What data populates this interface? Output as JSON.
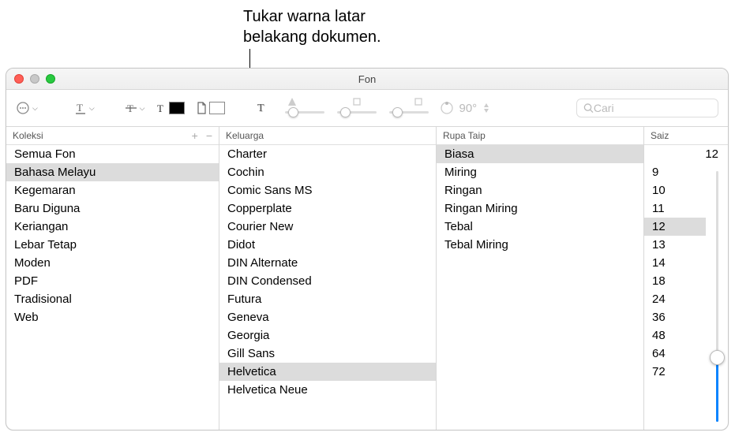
{
  "callout": "Tukar warna latar\nbelakang dokumen.",
  "window": {
    "title": "Fon",
    "search_placeholder": "Cari",
    "angle_label": "90°"
  },
  "headers": {
    "koleksi": "Koleksi",
    "keluarga": "Keluarga",
    "rupa": "Rupa Taip",
    "saiz": "Saiz",
    "plus": "+",
    "minus": "−"
  },
  "koleksi": {
    "items": [
      "Semua Fon",
      "Bahasa Melayu",
      "Kegemaran",
      "Baru Diguna",
      "Keriangan",
      "Lebar Tetap",
      "Moden",
      "PDF",
      "Tradisional",
      "Web"
    ],
    "selected": "Bahasa Melayu"
  },
  "keluarga": {
    "items": [
      "Charter",
      "Cochin",
      "Comic Sans MS",
      "Copperplate",
      "Courier New",
      "Didot",
      "DIN Alternate",
      "DIN Condensed",
      "Futura",
      "Geneva",
      "Georgia",
      "Gill Sans",
      "Helvetica",
      "Helvetica Neue"
    ],
    "selected": "Helvetica"
  },
  "rupa": {
    "items": [
      "Biasa",
      "Miring",
      "Ringan",
      "Ringan Miring",
      "Tebal",
      "Tebal Miring"
    ],
    "selected": "Biasa"
  },
  "saiz": {
    "value": "12",
    "items": [
      "9",
      "10",
      "11",
      "12",
      "13",
      "14",
      "18",
      "24",
      "36",
      "48",
      "64",
      "72"
    ],
    "selected": "12"
  }
}
